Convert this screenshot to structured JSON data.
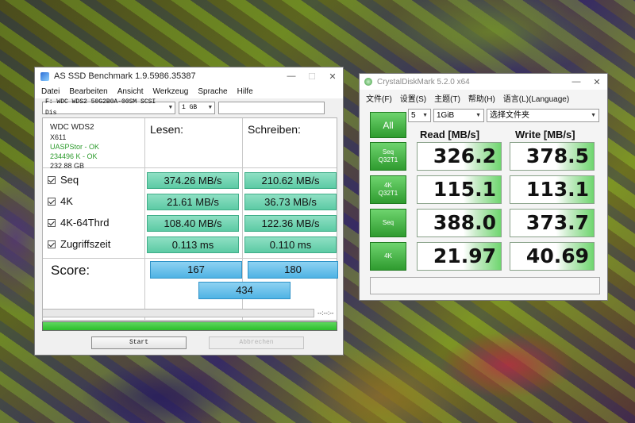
{
  "asssd": {
    "title": "AS SSD Benchmark 1.9.5986.35387",
    "window_controls": [
      "—",
      "☐",
      "✕"
    ],
    "menu": [
      "Datei",
      "Bearbeiten",
      "Ansicht",
      "Werkzeug",
      "Sprache",
      "Hilfe"
    ],
    "drive_select": "F: WDC WDS2 50G2B0A-00SM SCSI Dis",
    "size_select": "1 GB",
    "info": {
      "model": "WDC WDS2",
      "firmware": "X611",
      "driver": "UASPStor - OK",
      "alignment": "234496 K - OK",
      "capacity": "232.88 GB"
    },
    "headers": {
      "read": "Lesen:",
      "write": "Schreiben:"
    },
    "rows": [
      {
        "label": "Seq",
        "read": "374.26 MB/s",
        "write": "210.62 MB/s"
      },
      {
        "label": "4K",
        "read": "21.61 MB/s",
        "write": "36.73 MB/s"
      },
      {
        "label": "4K-64Thrd",
        "read": "108.40 MB/s",
        "write": "122.36 MB/s"
      },
      {
        "label": "Zugriffszeit",
        "read": "0.113 ms",
        "write": "0.110 ms"
      }
    ],
    "score": {
      "label": "Score:",
      "read": "167",
      "write": "180",
      "total": "434"
    },
    "time_display": "--:--:--",
    "progress_fraction": 1.0,
    "start_button": "Start",
    "abort_button": "Abbrechen"
  },
  "cdm": {
    "title": "CrystalDiskMark 5.2.0 x64",
    "window_controls": [
      "—",
      "✕"
    ],
    "menu": [
      "文件(F)",
      "设置(S)",
      "主题(T)",
      "帮助(H)",
      "语言(L)(Language)"
    ],
    "runs": "5",
    "size": "1GiB",
    "folder": "选择文件夹",
    "all_button": "All",
    "headers": {
      "read": "Read [MB/s]",
      "write": "Write [MB/s]"
    },
    "rows": [
      {
        "btn_line1": "Seq",
        "btn_line2": "Q32T1",
        "read": "326.2",
        "write": "378.5"
      },
      {
        "btn_line1": "4K",
        "btn_line2": "Q32T1",
        "read": "115.1",
        "write": "113.1"
      },
      {
        "btn_line1": "Seq",
        "btn_line2": "",
        "read": "388.0",
        "write": "373.7"
      },
      {
        "btn_line1": "4K",
        "btn_line2": "",
        "read": "21.97",
        "write": "40.69"
      }
    ]
  }
}
